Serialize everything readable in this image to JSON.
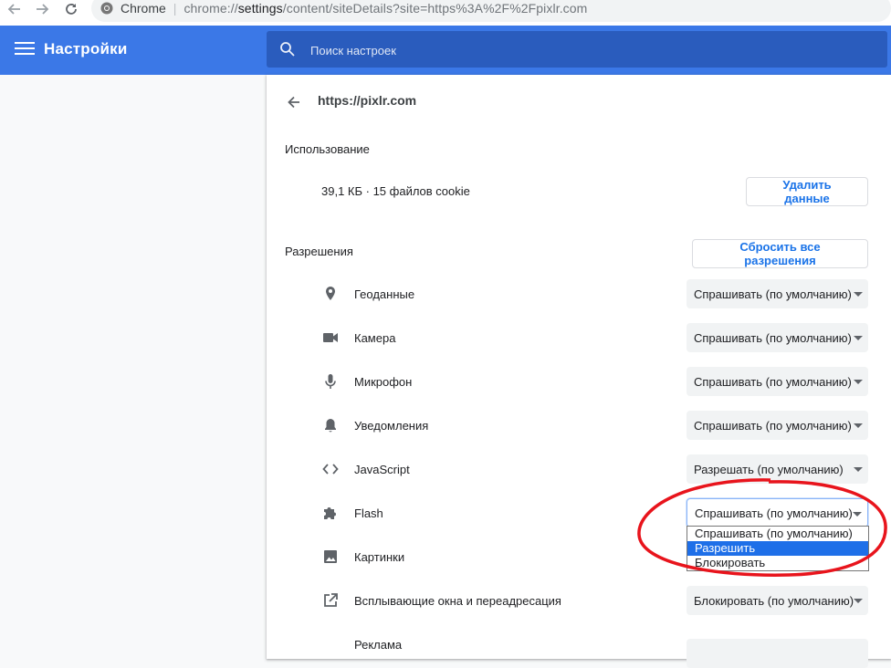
{
  "browser": {
    "site_label": "Chrome",
    "separator": "|",
    "url_prefix": "chrome://",
    "url_host": "settings",
    "url_rest": "/content/siteDetails?site=https%3A%2F%2Fpixlr.com"
  },
  "header": {
    "title": "Настройки",
    "search_placeholder": "Поиск настроек",
    "color": "#3b78e7"
  },
  "site": {
    "title": "https://pixlr.com"
  },
  "usage": {
    "label": "Использование",
    "text": "39,1 КБ · 15 файлов cookie",
    "clear_button": "Удалить данные"
  },
  "permissions": {
    "label": "Разрешения",
    "reset_button": "Сбросить все разрешения",
    "items": [
      {
        "label": "Геоданные",
        "value": "Спрашивать (по умолчанию)",
        "icon": "location-pin-icon"
      },
      {
        "label": "Камера",
        "value": "Спрашивать (по умолчанию)",
        "icon": "camera-icon"
      },
      {
        "label": "Микрофон",
        "value": "Спрашивать (по умолчанию)",
        "icon": "microphone-icon"
      },
      {
        "label": "Уведомления",
        "value": "Спрашивать (по умолчанию)",
        "icon": "bell-icon"
      },
      {
        "label": "JavaScript",
        "value": "Разрешать (по умолчанию)",
        "icon": "code-icon"
      },
      {
        "label": "Flash",
        "value": "Спрашивать (по умолчанию)",
        "icon": "puzzle-icon"
      },
      {
        "label": "Картинки",
        "value": "",
        "icon": "image-icon"
      },
      {
        "label": "Всплывающие окна и переадресация",
        "value": "Блокировать (по умолчанию)",
        "icon": "open-in-new-icon"
      },
      {
        "label": "Реклама",
        "value": "",
        "icon": ""
      }
    ]
  },
  "flash_dropdown": {
    "options": [
      "Спрашивать (по умолчанию)",
      "Разрешить",
      "Блокировать"
    ],
    "highlighted": "Разрешить"
  },
  "colors": {
    "accent": "#1a73e8",
    "highlight": "#1e6fe8",
    "annotation": "#e8141c"
  }
}
